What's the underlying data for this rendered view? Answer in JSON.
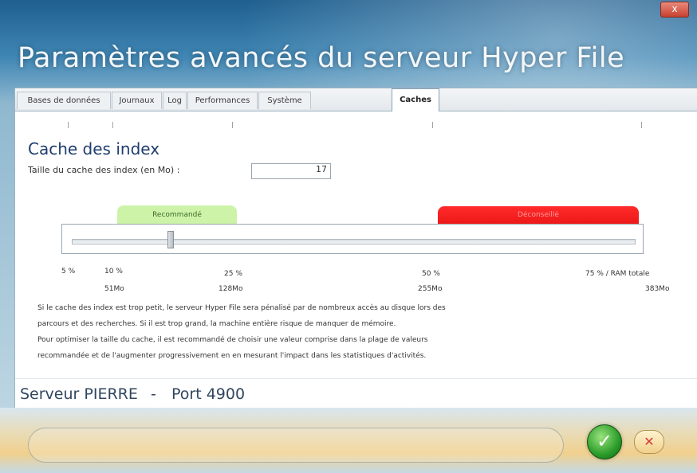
{
  "window": {
    "title": "Paramètres avancés du serveur Hyper File",
    "close_label": "x"
  },
  "tabs": [
    {
      "label": "Bases de données",
      "active": false
    },
    {
      "label": "Journaux",
      "active": false
    },
    {
      "label": "Log",
      "active": false
    },
    {
      "label": "Performances",
      "active": false
    },
    {
      "label": "Système",
      "active": false
    },
    {
      "label": "Caches",
      "active": true
    }
  ],
  "cache_index": {
    "section_title": "Cache des index",
    "field_label": "Taille du cache des index (en Mo) :",
    "field_value": "17",
    "recommended_label": "Recommandé",
    "discouraged_label": "Déconseillé",
    "slider": {
      "min_label": "5 %",
      "labels": [
        {
          "percent": "5 %",
          "size": ""
        },
        {
          "percent": "10 %",
          "size": "51Mo"
        },
        {
          "percent": "25 %",
          "size": "128Mo"
        },
        {
          "percent": "50 %",
          "size": "255Mo"
        },
        {
          "percent": "75 % / RAM totale",
          "size": "383Mo"
        }
      ]
    }
  },
  "description": [
    "Si le cache des index est trop petit, le serveur Hyper File sera pénalisé par de nombreux accès au disque lors des",
    "parcours et des recherches. Si il est trop grand, la machine entière risque de manquer de mémoire.",
    "Pour optimiser la taille du cache, il est recommandé de choisir une valeur comprise dans la plage de valeurs",
    "recommandée et de l'augmenter progressivement en en mesurant l'impact dans les statistiques d'activités."
  ],
  "server": {
    "name_label": "Serveur PIERRE",
    "separator": "-",
    "port_label": "Port 4900"
  },
  "buttons": {
    "ok_icon": "✓",
    "cancel_icon": "✕"
  }
}
